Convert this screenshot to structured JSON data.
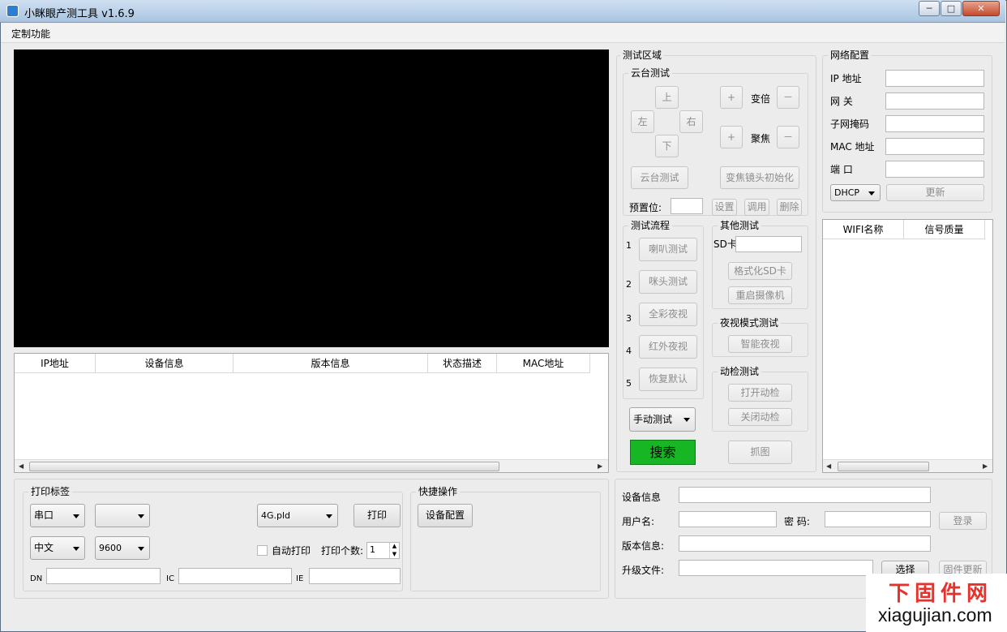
{
  "window": {
    "title": "小眯眼产测工具 v1.6.9",
    "min": "─",
    "max": "□",
    "close": "✕"
  },
  "menu": {
    "custom": "定制功能"
  },
  "device_table": {
    "columns": [
      "IP地址",
      "设备信息",
      "版本信息",
      "状态描述",
      "MAC地址"
    ]
  },
  "test_area": {
    "title": "测试区域",
    "ptz": {
      "title": "云台测试",
      "up": "上",
      "left": "左",
      "right": "右",
      "down": "下",
      "zoom_plus": "+",
      "zoom_label": "变倍",
      "zoom_minus": "－",
      "focus_plus": "+",
      "focus_label": "聚焦",
      "focus_minus": "－",
      "ptz_test": "云台测试",
      "lens_init": "变焦镜头初始化",
      "preset_label": "预置位:",
      "set": "设置",
      "call": "调用",
      "delete": "删除"
    },
    "flow": {
      "title": "测试流程",
      "steps": [
        {
          "num": "1",
          "label": "喇叭测试"
        },
        {
          "num": "2",
          "label": "咪头测试"
        },
        {
          "num": "3",
          "label": "全彩夜视"
        },
        {
          "num": "4",
          "label": "红外夜视"
        },
        {
          "num": "5",
          "label": "恢复默认"
        }
      ]
    },
    "other": {
      "title": "其他测试",
      "sd_label": "SD卡",
      "format_sd": "格式化SD卡",
      "reboot": "重启摄像机"
    },
    "night": {
      "title": "夜视模式测试",
      "smart": "智能夜视"
    },
    "motion": {
      "title": "动检测试",
      "open": "打开动检",
      "close": "关闭动检"
    },
    "mode": "手动测试",
    "search": "搜索",
    "capture": "抓图"
  },
  "network": {
    "title": "网络配置",
    "ip": "IP  地址",
    "gateway": "网    关",
    "mask": "子网掩码",
    "mac": "MAC 地址",
    "port": "端    口",
    "dhcp": "DHCP",
    "update": "更新"
  },
  "wifi_table": {
    "columns": [
      "WIFI名称",
      "信号质量"
    ]
  },
  "print": {
    "title": "打印标签",
    "port": "串口",
    "port2": "",
    "file": "4G.pld",
    "print": "打印",
    "lang": "中文",
    "baud": "9600",
    "auto_print": "自动打印",
    "count_label": "打印个数:",
    "count": "1",
    "dn": "DN",
    "ic": "IC",
    "ie": "IE"
  },
  "quick": {
    "title": "快捷操作",
    "device_config": "设备配置"
  },
  "device": {
    "info_label": "设备信息",
    "user_label": "用户名:",
    "pwd_label": "密  码:",
    "login": "登录",
    "version_label": "版本信息:",
    "upgrade_label": "升级文件:",
    "select": "选择",
    "firmware": "固件更新"
  },
  "watermark": {
    "top": "下固件网",
    "bottom": "xiagujian.com"
  },
  "colors": {
    "search_green": "#17b624",
    "title_gradient": "#a9c4e0",
    "watermark_red": "#e8312b"
  }
}
